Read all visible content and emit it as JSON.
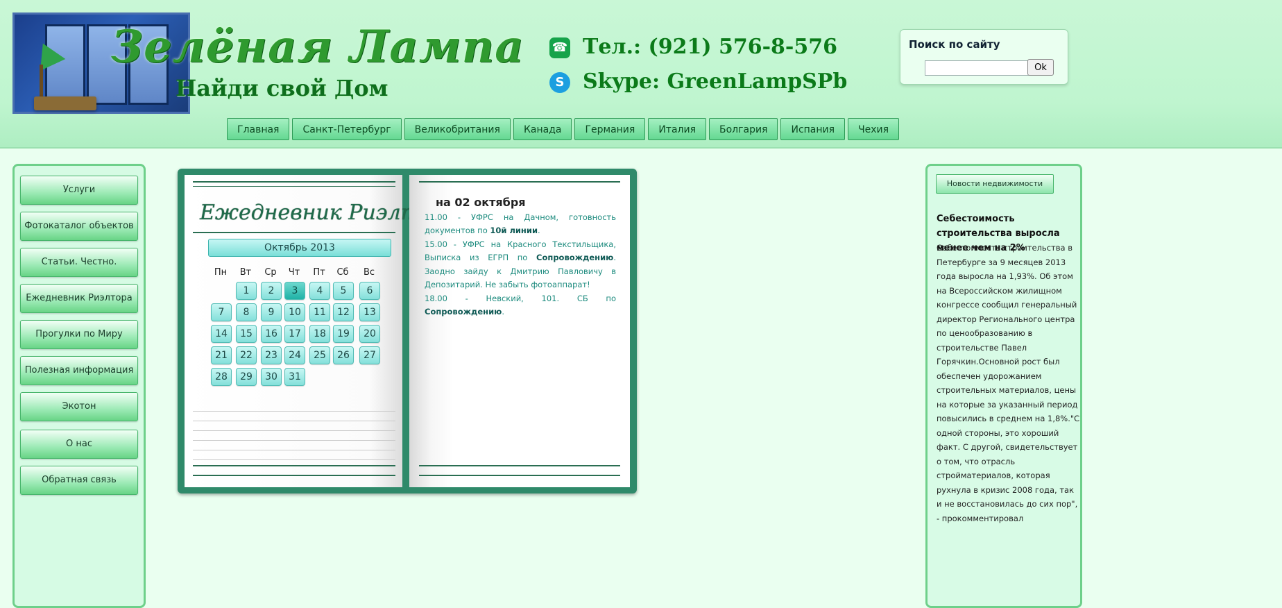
{
  "header": {
    "logo_title": "Зелёная Лампа",
    "logo_subtitle": "Найди свой Дом",
    "phone": "Тел.: (921) 576-8-576",
    "skype": "Skype: GreenLampSPb",
    "search": {
      "title": "Поиск по сайту",
      "value": "",
      "button": "Ok"
    }
  },
  "nav": [
    "Главная",
    "Санкт-Петербург",
    "Великобритания",
    "Канада",
    "Германия",
    "Италия",
    "Болгария",
    "Испания",
    "Чехия"
  ],
  "sidebar": [
    "Услуги",
    "Фотокаталог объектов",
    "Статьи. Честно.",
    "Ежедневник Риэлтора",
    "Прогулки по Миру",
    "Полезная информация",
    "Экотон",
    "О нас",
    "Обратная связь"
  ],
  "planner": {
    "title": "Ежедневник Риэлтора",
    "calendar": {
      "month": "Октябрь 2013",
      "weekdays": [
        "Пн",
        "Вт",
        "Ср",
        "Чт",
        "Пт",
        "Сб",
        "Вс"
      ],
      "first_weekday_index": 1,
      "days": 31,
      "selected_day": 3
    },
    "entries_date": "на 02 октября",
    "entries": [
      {
        "time": "11.00",
        "text": " - УФРС на Дачном, готовность документов по ",
        "bold": "10й линии",
        "after": "."
      },
      {
        "time": "15.00",
        "text": " - УФРС на Красного Текстильщика, Выписка из ЕГРП по ",
        "bold": "Сопровождению",
        "after": ". Заодно зайду к Дмитрию Павловичу в Депозитарий. Не забыть фотоаппарат!"
      },
      {
        "time": "18.00",
        "text": " - Невский, 101. СБ по ",
        "bold": "Сопровождению",
        "after": "."
      }
    ]
  },
  "news": {
    "tab": "Новости недвижимости",
    "headline": "Себестоимость строительства выросла менее чем на 2%",
    "body": "Себестоимость строительства в Петербурге за 9 месяцев 2013 года выросла на 1,93%. Об этом на Всероссийском жилищном конгрессе сообщил генеральный директор Регионального центра по ценообразованию в строительстве Павел Горячкин.Основной рост был обеспечен удорожанием строительных материалов, цены на которые за указанный период повысились в среднем на 1,8%.\"С одной стороны, это хороший факт. С другой, свидетельствует о том, что отрасль стройматериалов, которая рухнула в кризис 2008 года, так и не восстановилась до сих пор\", - прокомментировал"
  },
  "icons": {
    "phone": "phone-icon",
    "skype": "skype-icon"
  },
  "colors": {
    "header_bg": "#c9f7d6",
    "nav_button": "#64d892",
    "logo_text": "#2f9a2f",
    "contact_text": "#0b7a19",
    "planner_cover": "#2f8a6a",
    "calendar_day": "#84e0da"
  }
}
